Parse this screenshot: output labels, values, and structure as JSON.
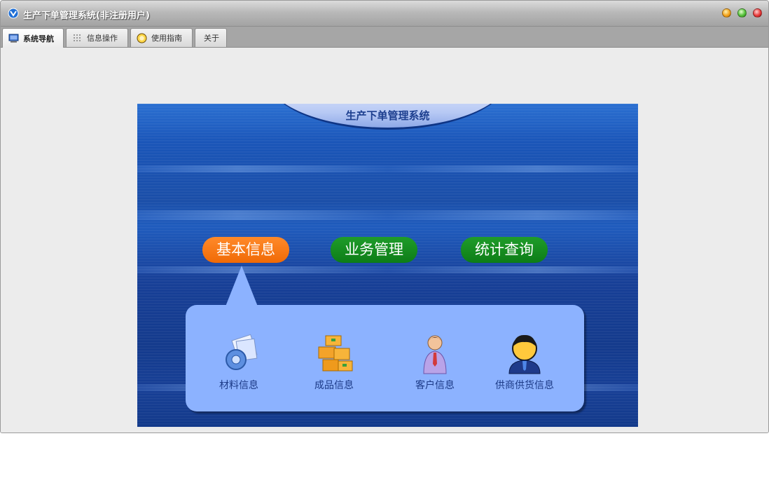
{
  "window": {
    "title": "生产下单管理系统(非注册用户)"
  },
  "tabs": [
    {
      "label": "系统导航",
      "icon": "monitor-icon",
      "active": true
    },
    {
      "label": "信息操作",
      "icon": "grid-icon",
      "active": false
    },
    {
      "label": "使用指南",
      "icon": "help-circle-icon",
      "active": false
    },
    {
      "label": "关于",
      "icon": "",
      "active": false
    }
  ],
  "panel": {
    "title": "生产下单管理系统",
    "categories": [
      {
        "label": "基本信息",
        "color": "#f06a06",
        "selected": true
      },
      {
        "label": "业务管理",
        "color": "#0d7d17",
        "selected": false
      },
      {
        "label": "统计查询",
        "color": "#0d7d17",
        "selected": false
      }
    ],
    "items": [
      {
        "label": "材料信息",
        "icon": "materials-gear-icon"
      },
      {
        "label": "成品信息",
        "icon": "boxes-icon"
      },
      {
        "label": "客户信息",
        "icon": "customer-person-icon"
      },
      {
        "label": "供商供货信息",
        "icon": "supplier-person-icon"
      }
    ]
  }
}
